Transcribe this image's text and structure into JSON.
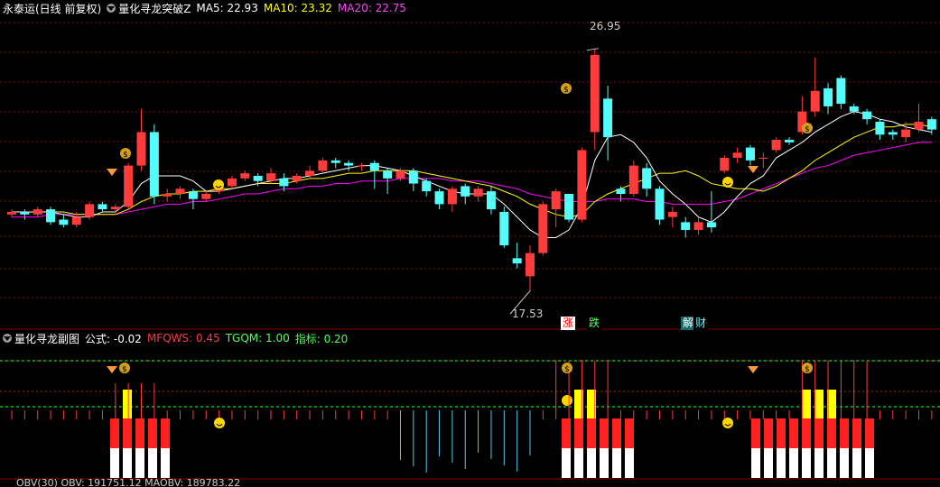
{
  "main_header": {
    "stock": "永泰运(日线 前复权)",
    "indicator": "量化寻龙突破Z",
    "ma5_label": "MA5: 22.93",
    "ma10_label": "MA10: 23.32",
    "ma20_label": "MA20: 22.75"
  },
  "sub_header": {
    "indicator": "量化寻龙副图",
    "formula_label": "公式: -0.02",
    "mfqws_label": "MFQWS: 0.45",
    "tgqm_label": "TGQM: 1.00",
    "zhibiao_label": "指标: 0.20"
  },
  "bottom_header": {
    "text": "OBV(30)  OBV: 191751.12  MAOBV: 189783.22"
  },
  "annotations": {
    "high": "26.95",
    "low": "17.53",
    "zhang": "涨",
    "die": "跌",
    "jie": "解",
    "cai": "财"
  },
  "colors": {
    "up": "#ff3b3b",
    "down": "#54fcfc",
    "ma5": "#ffffff",
    "ma10": "#ffff00",
    "ma20": "#ff00ff",
    "grid": "#7a1010"
  },
  "chart_data": {
    "type": "candlestick",
    "price_range": [
      16.5,
      28.2
    ],
    "series": [
      {
        "name": "MA5",
        "value": 22.93
      },
      {
        "name": "MA10",
        "value": 23.32
      },
      {
        "name": "MA20",
        "value": 22.75
      }
    ],
    "candles": [
      [
        20.5,
        20.6,
        20.4,
        20.7
      ],
      [
        20.6,
        20.5,
        20.3,
        20.7
      ],
      [
        20.5,
        20.7,
        20.4,
        20.8
      ],
      [
        20.7,
        20.2,
        20.1,
        20.8
      ],
      [
        20.3,
        20.1,
        20.0,
        20.5
      ],
      [
        20.1,
        20.4,
        20.0,
        20.6
      ],
      [
        20.4,
        20.9,
        20.3,
        21.0
      ],
      [
        20.9,
        20.7,
        20.6,
        21.0
      ],
      [
        20.7,
        20.8,
        20.5,
        20.9
      ],
      [
        20.8,
        22.4,
        20.7,
        22.5
      ],
      [
        22.4,
        23.7,
        22.2,
        24.6
      ],
      [
        23.7,
        21.2,
        20.9,
        24.0
      ],
      [
        21.2,
        21.3,
        21.0,
        21.5
      ],
      [
        21.3,
        21.5,
        21.1,
        21.6
      ],
      [
        21.4,
        21.1,
        20.7,
        21.5
      ],
      [
        21.1,
        21.3,
        21.0,
        21.4
      ],
      [
        21.4,
        21.6,
        21.3,
        21.8
      ],
      [
        21.6,
        21.9,
        21.5,
        22.0
      ],
      [
        21.9,
        22.1,
        21.8,
        22.2
      ],
      [
        22.0,
        21.8,
        21.6,
        22.1
      ],
      [
        21.8,
        22.1,
        21.7,
        22.3
      ],
      [
        21.9,
        21.6,
        21.4,
        22.1
      ],
      [
        21.8,
        22.0,
        21.7,
        22.1
      ],
      [
        22.0,
        22.2,
        21.9,
        22.4
      ],
      [
        22.2,
        22.6,
        22.1,
        22.7
      ],
      [
        22.6,
        22.5,
        22.3,
        22.7
      ],
      [
        22.5,
        22.4,
        22.2,
        22.6
      ],
      [
        22.4,
        22.4,
        22.2,
        22.5
      ],
      [
        22.5,
        22.2,
        21.5,
        22.6
      ],
      [
        22.2,
        21.9,
        21.3,
        22.3
      ],
      [
        21.9,
        22.2,
        21.8,
        22.3
      ],
      [
        22.2,
        21.7,
        21.4,
        22.3
      ],
      [
        21.8,
        21.4,
        21.2,
        21.9
      ],
      [
        21.4,
        20.9,
        20.7,
        21.5
      ],
      [
        20.9,
        21.5,
        20.6,
        21.6
      ],
      [
        21.6,
        21.2,
        20.9,
        21.7
      ],
      [
        21.2,
        21.5,
        21.0,
        21.6
      ],
      [
        21.4,
        20.7,
        20.5,
        21.6
      ],
      [
        20.6,
        19.3,
        19.2,
        20.8
      ],
      [
        18.8,
        18.6,
        18.4,
        19.4
      ],
      [
        18.1,
        19.0,
        17.5,
        19.3
      ],
      [
        19.0,
        20.9,
        18.9,
        21.0
      ],
      [
        20.7,
        21.4,
        20.0,
        21.5
      ],
      [
        21.3,
        20.3,
        20.2,
        20.6
      ],
      [
        20.3,
        23.0,
        20.2,
        23.1
      ],
      [
        23.7,
        26.7,
        23.0,
        26.95
      ],
      [
        25.0,
        23.5,
        22.6,
        25.5
      ],
      [
        21.5,
        21.3,
        21.0,
        21.6
      ],
      [
        21.3,
        22.4,
        21.2,
        22.6
      ],
      [
        22.3,
        21.5,
        21.2,
        22.5
      ],
      [
        21.5,
        20.3,
        20.1,
        21.6
      ],
      [
        20.4,
        20.6,
        20.0,
        20.8
      ],
      [
        20.2,
        19.9,
        19.6,
        20.4
      ],
      [
        19.9,
        20.2,
        19.7,
        20.4
      ],
      [
        20.2,
        20.0,
        19.8,
        21.4
      ],
      [
        22.2,
        22.7,
        22.1,
        22.8
      ],
      [
        22.7,
        22.9,
        22.5,
        23.1
      ],
      [
        23.1,
        22.6,
        22.4,
        23.2
      ],
      [
        22.7,
        22.7,
        22.3,
        22.9
      ],
      [
        23.0,
        23.4,
        22.9,
        23.5
      ],
      [
        23.4,
        23.3,
        23.2,
        23.5
      ],
      [
        23.7,
        24.5,
        23.6,
        25.1
      ],
      [
        24.5,
        25.3,
        24.3,
        26.6
      ],
      [
        25.4,
        24.7,
        24.4,
        25.6
      ],
      [
        25.8,
        24.8,
        24.6,
        25.9
      ],
      [
        24.7,
        24.5,
        24.4,
        24.8
      ],
      [
        24.5,
        24.2,
        24.0,
        24.6
      ],
      [
        24.1,
        23.6,
        23.4,
        24.2
      ],
      [
        23.7,
        23.6,
        23.4,
        23.8
      ],
      [
        23.5,
        23.8,
        23.3,
        24.1
      ],
      [
        23.8,
        24.1,
        23.7,
        24.8
      ],
      [
        24.2,
        23.8,
        23.6,
        24.3
      ]
    ],
    "ma5_path": [
      20.6,
      20.6,
      20.6,
      20.6,
      20.5,
      20.4,
      20.4,
      20.6,
      20.6,
      21.0,
      21.7,
      22.0,
      22.0,
      22.0,
      21.8,
      21.4,
      21.4,
      21.5,
      21.6,
      21.7,
      21.8,
      21.9,
      21.9,
      22.0,
      22.1,
      22.2,
      22.3,
      22.4,
      22.4,
      22.3,
      22.2,
      22.0,
      21.8,
      21.6,
      21.4,
      21.3,
      21.3,
      21.3,
      20.9,
      20.4,
      19.9,
      19.6,
      19.6,
      19.9,
      20.8,
      22.6,
      23.5,
      23.6,
      23.3,
      22.7,
      21.8,
      21.3,
      20.9,
      20.4,
      20.2,
      20.6,
      21.2,
      21.7,
      22.0,
      22.7,
      23.0,
      23.3,
      23.7,
      24.0,
      24.3,
      24.5,
      24.4,
      24.2,
      24.1,
      23.9,
      23.8,
      23.7
    ],
    "ma10_path": [
      20.6,
      20.6,
      20.6,
      20.6,
      20.6,
      20.5,
      20.5,
      20.5,
      20.5,
      20.7,
      21.0,
      21.2,
      21.3,
      21.3,
      21.4,
      21.4,
      21.5,
      21.5,
      21.6,
      21.7,
      21.7,
      21.7,
      21.8,
      21.9,
      21.9,
      22.0,
      22.1,
      22.1,
      22.2,
      22.2,
      22.2,
      22.2,
      22.1,
      22.0,
      21.9,
      21.8,
      21.7,
      21.6,
      21.4,
      21.2,
      20.9,
      20.7,
      20.5,
      20.4,
      20.5,
      21.0,
      21.3,
      21.5,
      21.7,
      21.9,
      22.1,
      22.1,
      22.2,
      22.0,
      21.7,
      21.6,
      21.5,
      21.5,
      21.4,
      21.6,
      21.9,
      22.2,
      22.6,
      22.9,
      23.2,
      23.5,
      23.7,
      23.9,
      23.9,
      24.0,
      24.0,
      23.9
    ],
    "ma20_path": [
      20.4,
      20.4,
      20.4,
      20.5,
      20.5,
      20.5,
      20.5,
      20.5,
      20.5,
      20.6,
      20.7,
      20.8,
      20.9,
      20.9,
      21.0,
      21.0,
      21.1,
      21.2,
      21.3,
      21.3,
      21.4,
      21.5,
      21.5,
      21.6,
      21.6,
      21.7,
      21.7,
      21.8,
      21.8,
      21.8,
      21.9,
      21.9,
      21.9,
      21.9,
      21.8,
      21.8,
      21.8,
      21.7,
      21.6,
      21.5,
      21.3,
      21.2,
      21.1,
      21.0,
      21.0,
      21.0,
      21.1,
      21.1,
      21.1,
      21.0,
      21.0,
      20.9,
      20.9,
      20.9,
      20.9,
      21.0,
      21.1,
      21.3,
      21.5,
      21.7,
      21.9,
      22.1,
      22.3,
      22.4,
      22.6,
      22.8,
      22.9,
      23.0,
      23.1,
      23.2,
      23.3,
      23.3
    ]
  }
}
